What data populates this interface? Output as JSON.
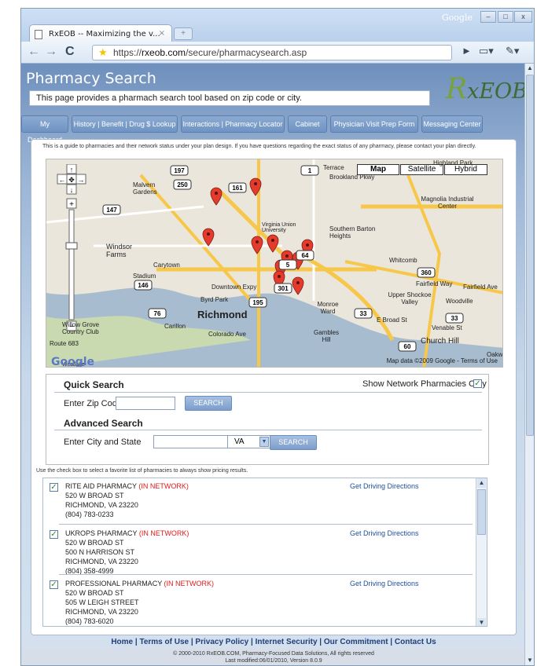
{
  "browser": {
    "tab_title": "RxEOB -- Maximizing the v...",
    "tab_close": "×",
    "new_tab": "+",
    "google_label": "Google",
    "min": "–",
    "max": "□",
    "close": "x",
    "back": "←",
    "forward": "→",
    "reload": "C",
    "url_scheme": "https://",
    "url_host": "rxeob.com",
    "url_path": "/secure/pharmacysearch.asp",
    "go": "►",
    "page_menu": "▭▾",
    "tools_menu": "✎▾"
  },
  "page": {
    "title": "Pharmacy Search",
    "intro": "This page provides a pharmach search tool based on zip code or city.",
    "logo_r": "R",
    "logo_x": "xEOB"
  },
  "nav": [
    "My Dashboard",
    "History | Benefit | Drug $ Lookup",
    "Interactions | Pharmacy Locator",
    "Cabinet",
    "Physician Visit Prep Form",
    "Messaging Center"
  ],
  "guide_text": "This is a guide to pharmacies and their network status under your plan design. If you have questions regarding the exact status of any pharmacy, please contact your plan directly.",
  "map": {
    "types": [
      "Map",
      "Satellite",
      "Hybrid"
    ],
    "labels": [
      "Terrace",
      "Brookland Pkwy",
      "Highland Park",
      "Malvern Gardens",
      "Virginia Union University",
      "Southern Barton Heights",
      "Magnolia Industrial Center",
      "Windsor Farms",
      "Carytown",
      "Stadium",
      "Whitcomb",
      "Downtown Expy",
      "Byrd Park",
      "Richmond",
      "Gambles Hill",
      "Upper Shockoe Valley",
      "Woodville",
      "Fairfield Ave",
      "Church Hill",
      "Carillon",
      "Colorado Ave",
      "Willow Grove Country Club",
      "Route 683",
      "Westlake",
      "Oakwo",
      "Venable St",
      "E Broad St",
      "Monroe Ward",
      "Fairfield Way"
    ],
    "route_nums": [
      "197",
      "250",
      "161",
      "1",
      "33",
      "147",
      "195",
      "76",
      "146",
      "360",
      "64",
      "5",
      "301",
      "60",
      "33"
    ],
    "google": "Google",
    "data": "Map data ©2009 Google - Terms of Use",
    "marker_color": "#e53b2c"
  },
  "search": {
    "quick_title": "Quick Search",
    "show_network": "Show Network Pharmacies Only",
    "zip_label": "Enter Zip Code",
    "zip_value": "",
    "search_btn": "SEARCH",
    "advanced_title": "Advanced Search",
    "city_label": "Enter City and State",
    "city_value": "",
    "state": "VA",
    "search_btn2": "SEARCH"
  },
  "fav_note": "Use the check box to select a favorite list of pharmacies to always show pricing results.",
  "pharmacies": [
    {
      "name": "RITE AID PHARMACY",
      "status": "(IN NETWORK)",
      "lines": [
        "520 W BROAD ST",
        "RICHMOND, VA 23220",
        "(804) 783-0233"
      ],
      "link": "Get Driving Directions"
    },
    {
      "name": "UKROPS PHARMACY",
      "status": "(IN NETWORK)",
      "lines": [
        "520 W BROAD ST",
        "500 N HARRISON ST",
        "RICHMOND, VA 23220",
        "(804) 358-4999"
      ],
      "link": "Get Driving Directions"
    },
    {
      "name": "PROFESSIONAL PHARMACY",
      "status": "(IN NETWORK)",
      "lines": [
        "520 W BROAD ST",
        "505 W LEIGH STREET",
        "RICHMOND, VA 23220",
        "(804) 783-6020"
      ],
      "link": "Get Driving Directions"
    }
  ],
  "footer": {
    "links": "Home | Terms of Use | Privacy Policy | Internet Security | Our Commitment | Contact Us",
    "copyright": "© 2000-2010 RxEOB.COM, Pharmacy-Focused Data Solutions, All rights reserved",
    "modified": "Last modified:06/01/2010,  Version 8.0.9"
  },
  "colors": {
    "accent": "#6f93c3",
    "in_network": "#e01a1a",
    "link": "#1f4f9e"
  }
}
